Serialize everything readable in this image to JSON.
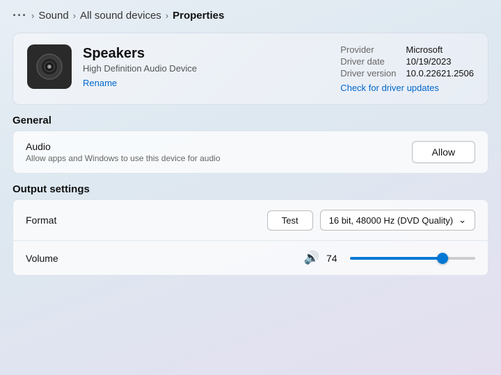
{
  "breadcrumb": {
    "dots": "···",
    "items": [
      {
        "label": "Sound",
        "bold": false
      },
      {
        "label": "All sound devices",
        "bold": false
      },
      {
        "label": "Properties",
        "bold": true
      }
    ]
  },
  "device": {
    "name": "Speakers",
    "subtitle": "High Definition Audio Device",
    "rename_label": "Rename",
    "provider_label": "Provider",
    "provider_value": "Microsoft",
    "driver_date_label": "Driver date",
    "driver_date_value": "10/19/2023",
    "driver_version_label": "Driver version",
    "driver_version_value": "10.0.22621.2506",
    "driver_update_label": "Check for driver updates"
  },
  "general_section": {
    "header": "General",
    "audio_row": {
      "title": "Audio",
      "description": "Allow apps and Windows to use this device for audio",
      "button_label": "Allow"
    }
  },
  "output_section": {
    "header": "Output settings",
    "format_row": {
      "title": "Format",
      "test_label": "Test",
      "format_value": "16 bit, 48000 Hz (DVD Quality)"
    },
    "volume_row": {
      "title": "Volume",
      "value": 74,
      "fill_percent": 74
    }
  }
}
